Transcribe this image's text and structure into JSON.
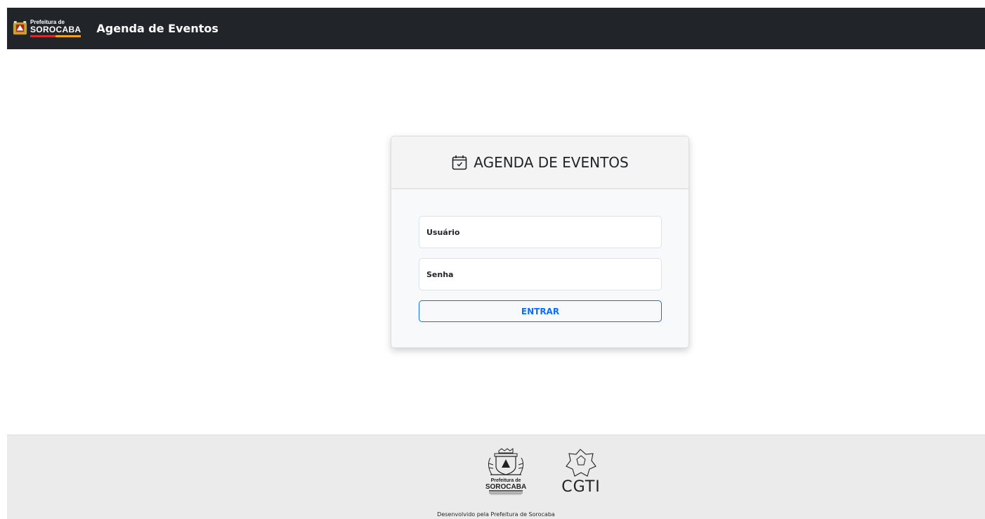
{
  "navbar": {
    "brand_small": "Prefeitura de",
    "brand_big": "SOROCABA",
    "title": "Agenda de Eventos"
  },
  "login": {
    "title": "AGENDA DE EVENTOS",
    "user_placeholder": "Usuário",
    "password_placeholder": "Senha",
    "submit_label": "ENTRAR"
  },
  "footer": {
    "logo1_small": "Prefeitura de",
    "logo1_big": "SOROCABA",
    "logo2": "CGTI",
    "caption": "Desenvolvido pela Prefeitura de Sorocaba"
  },
  "colors": {
    "navbar_bg": "#212529",
    "accent": "#0d6efd",
    "footer_bg": "#ebebeb"
  }
}
